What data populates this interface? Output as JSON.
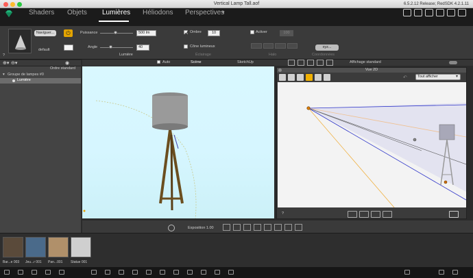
{
  "window": {
    "title": "Vertical Lamp Tall.aof",
    "version": "6.5.2.12 Release; RedSDK 4.2.1.11"
  },
  "tabs": [
    "Shaders",
    "Objets",
    "Lumières",
    "Héliodons",
    "Perspectives"
  ],
  "active_tab": "Lumières",
  "lumiere": {
    "naviguer_label": "Naviguer...",
    "preset_label": "default",
    "question": "?",
    "puissance_label": "Puissance",
    "puissance_value": "500 lm",
    "angle_label": "Angle",
    "angle_value": "40",
    "section_label": "Lumière"
  },
  "eclairage": {
    "ombre_label": "Ombre",
    "ombre_value": "10",
    "ombre_checked": true,
    "cone_label": "Cône lumineux",
    "cone_checked": false,
    "section_label": "Éclairage"
  },
  "halo": {
    "activer_label": "Activer",
    "activer_value": "100",
    "section_label": "Halo"
  },
  "coordonnees": {
    "xyz_label": "xyz...",
    "section_label": "Coordonnées"
  },
  "sidebar": {
    "sort_label": "Ordre standard",
    "group_label": "Groupe de lampes #0",
    "item_label": "Lumière"
  },
  "viewbar": {
    "auto_label": "Auto",
    "scene_label": "Scène",
    "sketchup_label": "SketchUp",
    "affichage_label": "Affichage standard"
  },
  "vue2d": {
    "title": "Vue 2D",
    "select_value": "Tout afficher",
    "question": "?"
  },
  "bottom": {
    "exposition_label": "Exposition 1.00"
  },
  "thumbnails": [
    "Bar...e 003",
    "Jeu...r 001",
    "Pan...001",
    "Statue 001"
  ],
  "colors": {
    "accent": "#ffb000",
    "background": "#2b2b2b",
    "sky": "#d8f7ff"
  }
}
